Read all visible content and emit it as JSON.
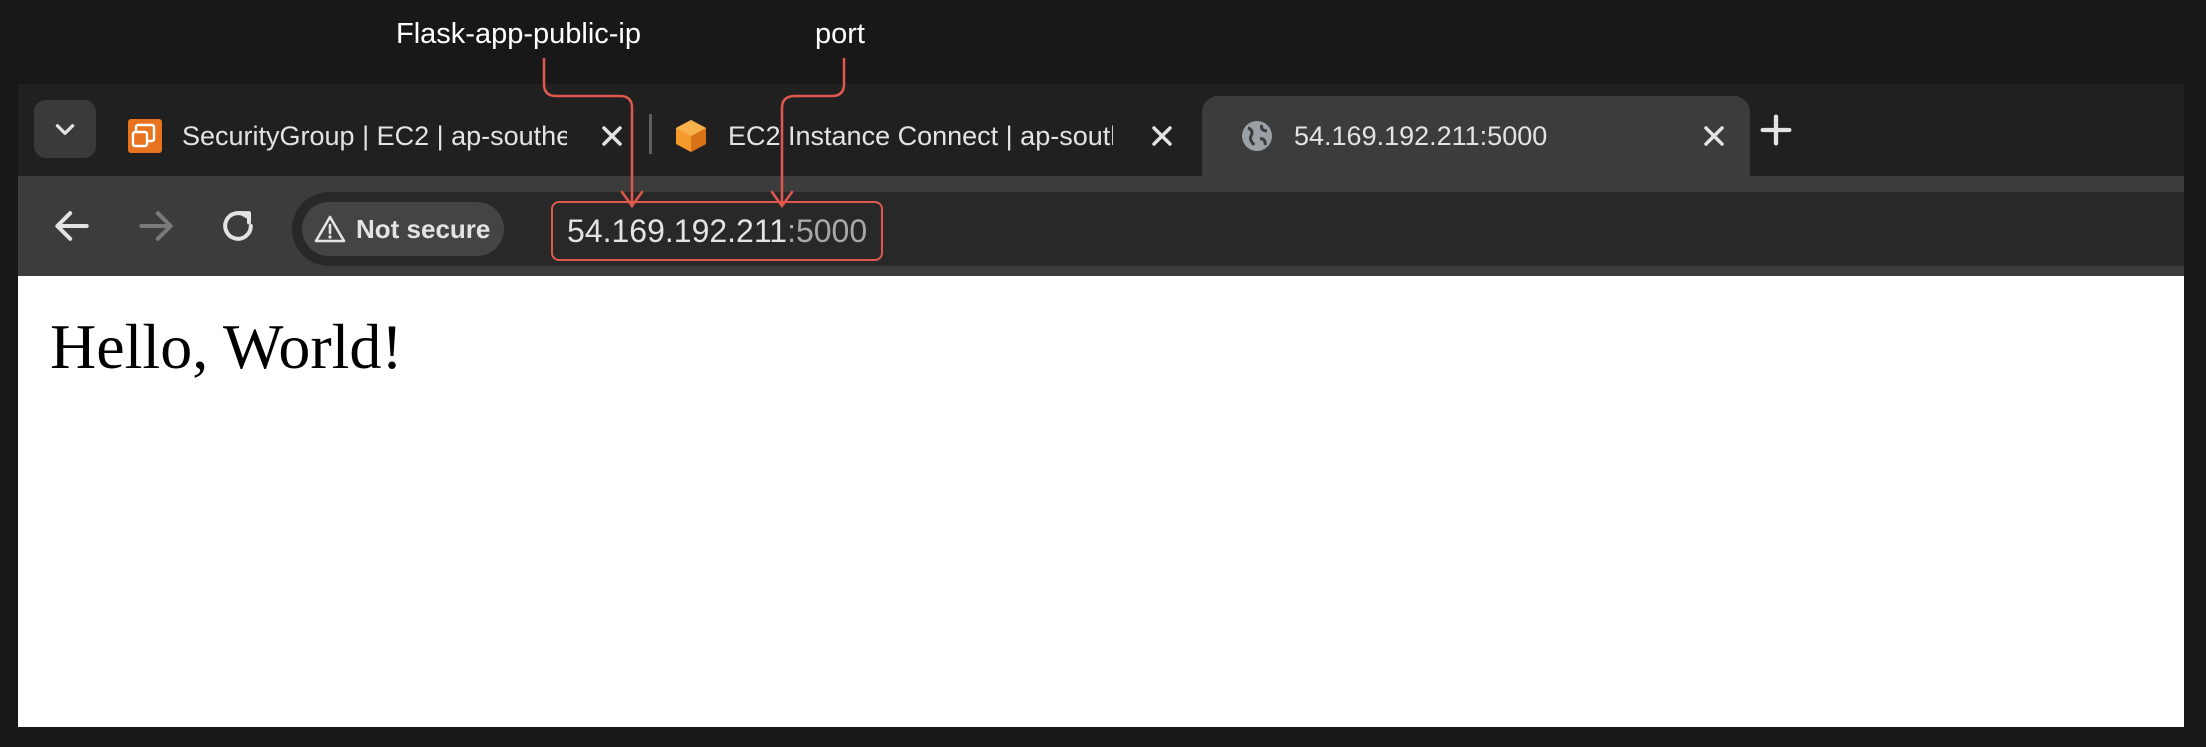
{
  "annotations": {
    "ip_label": "Flask-app-public-ip",
    "port_label": "port",
    "accent_color": "#e0584d"
  },
  "browser": {
    "tab_search_icon": "chevron-down-icon",
    "tabs": [
      {
        "title": "SecurityGroup | EC2 | ap-southe",
        "icon": "aws-security-group-icon",
        "active": false
      },
      {
        "title": "EC2 Instance Connect | ap-south",
        "icon": "aws-ec2-icon",
        "active": false
      },
      {
        "title": "54.169.192.211:5000",
        "icon": "globe-icon",
        "active": true
      }
    ],
    "new_tab_icon": "plus-icon",
    "toolbar": {
      "back_icon": "arrow-left-icon",
      "forward_icon": "arrow-right-icon",
      "reload_icon": "reload-icon",
      "security_chip": "Not secure",
      "url_host": "54.169.192.211",
      "url_port": ":5000"
    }
  },
  "page": {
    "heading": "Hello, World!"
  },
  "colors": {
    "window_bg": "#181818",
    "tabstrip_bg": "#202020",
    "toolbar_bg": "#3c3c3c",
    "aws_orange": "#e8731f"
  }
}
